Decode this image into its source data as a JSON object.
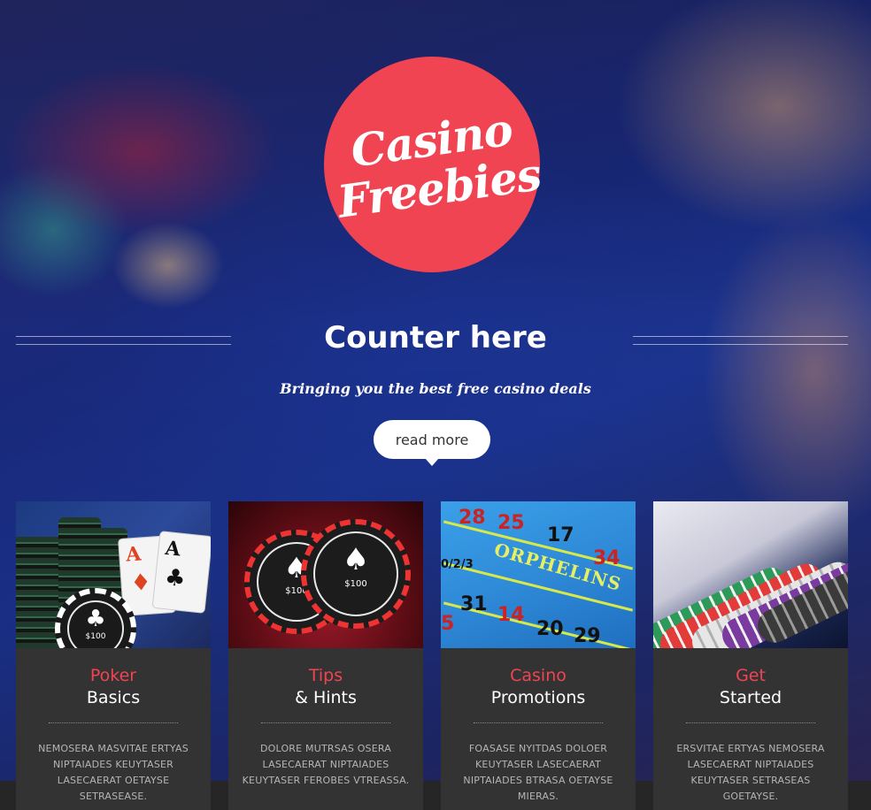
{
  "logo": {
    "line1": "Casino",
    "line2": "Freebies"
  },
  "hero": {
    "headline": "Counter here",
    "tagline": "Bringing you the best free casino deals",
    "cta": "read more"
  },
  "cards": [
    {
      "title_accent": "Poker",
      "title_main": "Basics",
      "body": "NEMOSERA MASVITAE ERTYAS NIPTAIADES KEUYTASER LASECAERAT OETAYSE SETRASEASE.",
      "image": {
        "playing_cards": [
          "A",
          "A"
        ],
        "chip_label": "$100"
      }
    },
    {
      "title_accent": "Tips",
      "title_main": "& Hints",
      "body": "DOLORE MUTRSAS OSERA LASECAERAT NIPTAIADES KEUYTASER FEROBES VTREASSA.",
      "image": {
        "chip_label": "$100"
      }
    },
    {
      "title_accent": "Casino",
      "title_main": "Promotions",
      "body": "FOASASE NYITDAS DOLOER KEUYTASER LASECAERAT NIPTAIADES BTRASA OETAYSE MIERAS.",
      "image": {
        "table_label": "ORPHELINS",
        "numbers": [
          "28",
          "25",
          "17",
          "34",
          "0/2/3",
          "31",
          "14",
          "20",
          "5",
          "29"
        ]
      }
    },
    {
      "title_accent": "Get",
      "title_main": "Started",
      "body": "ERSVITAE ERTYAS NEMOSERA LASECAERAT NIPTAIADES KEUYTASER SETRASEAS GOETAYSE.",
      "image": {}
    }
  ],
  "colors": {
    "accent": "#f04452",
    "card_bg": "#333333",
    "footer_bar": "#262626",
    "text_light": "#ffffff",
    "text_muted": "#b5b5b5"
  }
}
